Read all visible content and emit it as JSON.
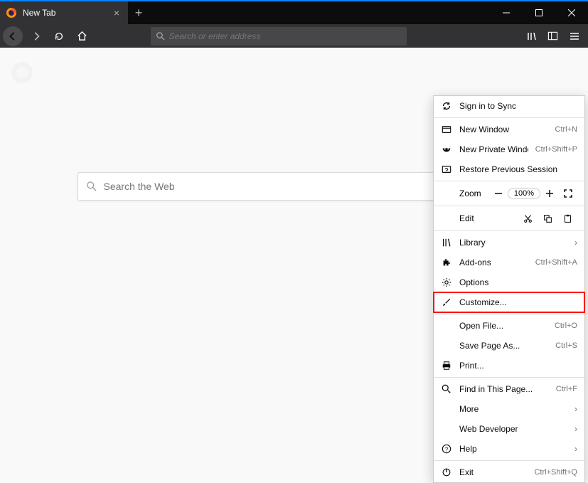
{
  "tab": {
    "title": "New Tab"
  },
  "urlbar": {
    "placeholder": "Search or enter address"
  },
  "search": {
    "placeholder": "Search the Web"
  },
  "menu": {
    "signin": "Sign in to Sync",
    "new_window": {
      "label": "New Window",
      "shortcut": "Ctrl+N"
    },
    "private": {
      "label": "New Private Window",
      "shortcut": "Ctrl+Shift+P"
    },
    "restore": "Restore Previous Session",
    "zoom": {
      "label": "Zoom",
      "value": "100%"
    },
    "edit": {
      "label": "Edit"
    },
    "library": "Library",
    "addons": {
      "label": "Add-ons",
      "shortcut": "Ctrl+Shift+A"
    },
    "options": "Options",
    "customize": "Customize...",
    "open_file": {
      "label": "Open File...",
      "shortcut": "Ctrl+O"
    },
    "save_as": {
      "label": "Save Page As...",
      "shortcut": "Ctrl+S"
    },
    "print": "Print...",
    "find": {
      "label": "Find in This Page...",
      "shortcut": "Ctrl+F"
    },
    "more": "More",
    "webdev": "Web Developer",
    "help": "Help",
    "exit": {
      "label": "Exit",
      "shortcut": "Ctrl+Shift+Q"
    }
  }
}
